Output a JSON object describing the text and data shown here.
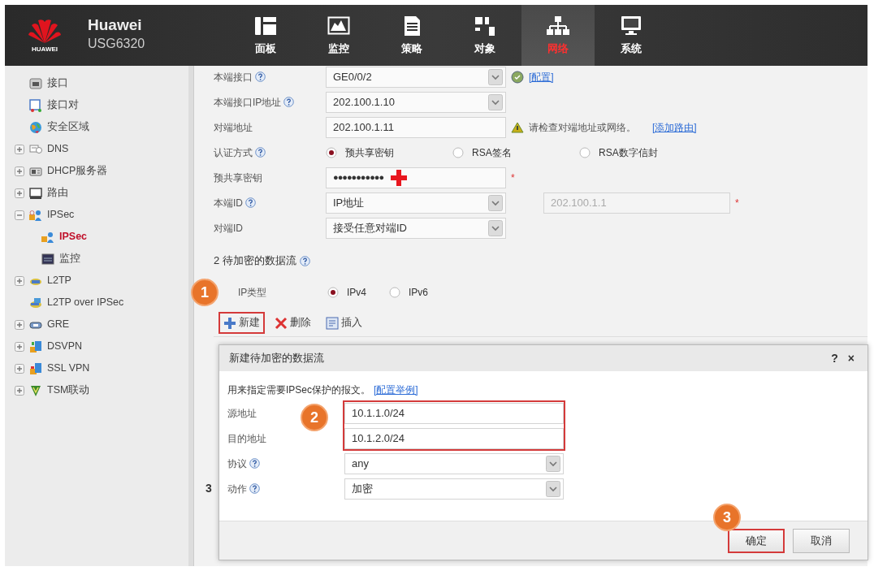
{
  "header": {
    "logo_text": "HUAWEI",
    "brand": "Huawei",
    "model": "USG6320"
  },
  "nav": [
    {
      "label": "面板",
      "selected": false
    },
    {
      "label": "监控",
      "selected": false
    },
    {
      "label": "策略",
      "selected": false
    },
    {
      "label": "对象",
      "selected": false
    },
    {
      "label": "网络",
      "selected": true
    },
    {
      "label": "系统",
      "selected": false
    }
  ],
  "sidebar": {
    "items": [
      {
        "kind": "leaf",
        "label": "接口",
        "selected": false
      },
      {
        "kind": "leaf",
        "label": "接口对",
        "selected": false
      },
      {
        "kind": "leaf",
        "label": "安全区域",
        "selected": false
      },
      {
        "kind": "group",
        "label": "DNS",
        "expanded": false,
        "selected": false
      },
      {
        "kind": "group",
        "label": "DHCP服务器",
        "expanded": false,
        "selected": false
      },
      {
        "kind": "group",
        "label": "路由",
        "expanded": false,
        "selected": false
      },
      {
        "kind": "group",
        "label": "IPSec",
        "expanded": true,
        "selected": false,
        "children": [
          {
            "label": "IPSec",
            "selected": true
          },
          {
            "label": "监控",
            "selected": false
          }
        ]
      },
      {
        "kind": "group",
        "label": "L2TP",
        "expanded": false,
        "selected": false
      },
      {
        "kind": "leaf",
        "label": "L2TP over IPSec",
        "selected": false
      },
      {
        "kind": "group",
        "label": "GRE",
        "expanded": false,
        "selected": false
      },
      {
        "kind": "group",
        "label": "DSVPN",
        "expanded": false,
        "selected": false
      },
      {
        "kind": "group",
        "label": "SSL VPN",
        "expanded": false,
        "selected": false
      },
      {
        "kind": "group",
        "label": "TSM联动",
        "expanded": false,
        "selected": false
      }
    ]
  },
  "form": {
    "rows": [
      {
        "kind": "select",
        "label": "本端接口",
        "help": true,
        "value": "GE0/0/2",
        "link": "[配置]"
      },
      {
        "kind": "select",
        "label": "本端接口IP地址",
        "help": true,
        "value": "202.100.1.10"
      },
      {
        "kind": "input",
        "label": "对端地址",
        "help": false,
        "value": "202.100.1.11",
        "hint": "请检查对端地址或网络。",
        "link": "[添加路由]"
      },
      {
        "kind": "radio",
        "label": "认证方式",
        "help": true,
        "options": [
          {
            "label": "预共享密钥",
            "selected": true
          },
          {
            "label": "RSA签名",
            "selected": false
          },
          {
            "label": "RSA数字信封",
            "selected": false
          }
        ]
      },
      {
        "kind": "password",
        "label": "预共享密钥",
        "help": false,
        "value": "●●●●●●●●●●●",
        "required": "*"
      },
      {
        "kind": "select",
        "label": "本端ID",
        "help": true,
        "value": "IP地址",
        "extra_value": "202.100.1.1",
        "required": "*"
      },
      {
        "kind": "select",
        "label": "对端ID",
        "help": false,
        "value": "接受任意对端ID"
      }
    ]
  },
  "flow_section": {
    "number": "2",
    "title": "待加密的数据流",
    "ip_type": {
      "label": "IP类型",
      "options": [
        {
          "label": "IPv4",
          "selected": true
        },
        {
          "label": "IPv6",
          "selected": false
        }
      ]
    },
    "toolbar": [
      {
        "kind": "add",
        "label": "新建",
        "highlighted": true,
        "step": "1"
      },
      {
        "kind": "delete",
        "label": "删除",
        "highlighted": false
      },
      {
        "kind": "insert",
        "label": "插入",
        "highlighted": false
      }
    ]
  },
  "section_3": {
    "number": "3"
  },
  "dialog": {
    "title": "新建待加密的数据流",
    "help": "?",
    "close": "×",
    "intro": "用来指定需要IPSec保护的报文。",
    "intro_link": "[配置举例]",
    "fields": [
      {
        "kind": "input",
        "label": "源地址",
        "help": false,
        "value": "10.1.1.0/24",
        "highlighted": true
      },
      {
        "kind": "input",
        "label": "目的地址",
        "help": false,
        "value": "10.1.2.0/24",
        "highlighted": true
      },
      {
        "kind": "select",
        "label": "协议",
        "help": true,
        "value": "any",
        "highlighted": false
      },
      {
        "kind": "select",
        "label": "动作",
        "help": true,
        "value": "加密",
        "highlighted": false
      }
    ],
    "highlight_step": "2",
    "buttons": [
      {
        "label": "确定",
        "highlighted": true,
        "step": "3"
      },
      {
        "label": "取消",
        "highlighted": false
      }
    ]
  }
}
